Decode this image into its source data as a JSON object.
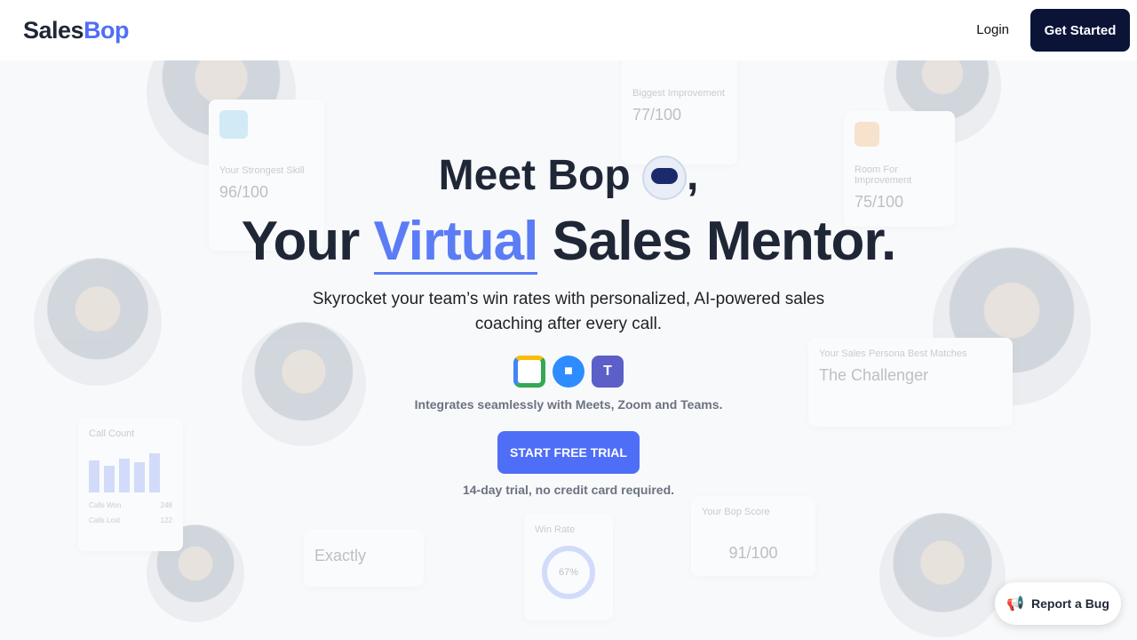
{
  "header": {
    "logo_part1": "Sales",
    "logo_part2": "Bop",
    "login": "Login",
    "get_started": "Get Started"
  },
  "hero": {
    "line1": "Meet Bop",
    "line1_suffix": ",",
    "line2_a": "Your ",
    "line2_highlight": "Virtual",
    "line2_b": " Sales Mentor.",
    "subtitle_1": "Skyrocket your team’s win rates with personalized, AI-powered sales",
    "subtitle_2": "coaching after every call.",
    "integrations": [
      "Google Meet",
      "Zoom",
      "Microsoft Teams"
    ],
    "integrations_text": "Integrates seamlessly with Meets, Zoom and Teams.",
    "cta": "START FREE TRIAL",
    "cta_note": "14-day trial, no credit card required."
  },
  "background_cards": {
    "strongest": {
      "label": "Your Strongest Skill",
      "value": "96/100"
    },
    "improvement": {
      "label": "Biggest Improvement",
      "value": "77/100"
    },
    "room": {
      "label": "Room For Improvement",
      "value": "75/100"
    },
    "persona": {
      "label": "Your Sales Persona Best Matches",
      "value": "The Challenger"
    },
    "calls": {
      "label": "Call Count",
      "won": "Calls Won",
      "won_value": "248",
      "lost": "Calls Lost",
      "lost_value": "122"
    },
    "win_rate": {
      "label": "Win Rate",
      "value": "67%"
    },
    "score": {
      "label": "Your Bop Score",
      "value": "91/100"
    },
    "layout": {
      "value": "Exactly"
    }
  },
  "report_bug": "Report a Bug",
  "colors": {
    "accent": "#4f6ef7",
    "dark": "#0b1437"
  }
}
